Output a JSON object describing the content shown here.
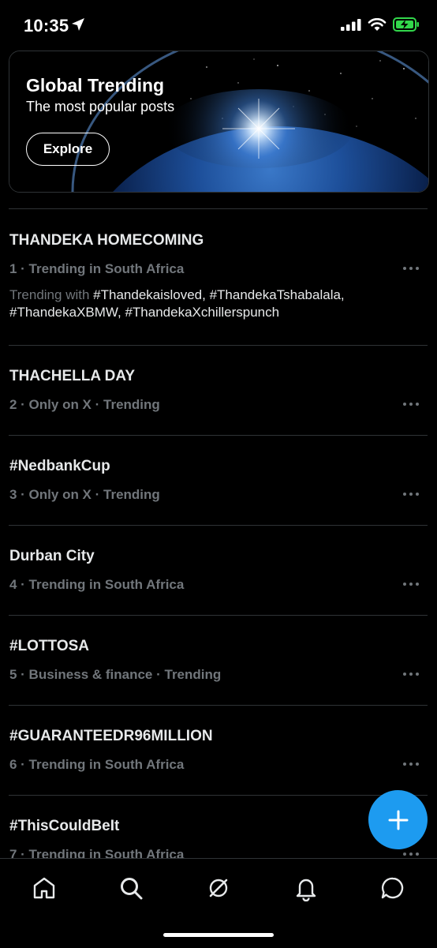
{
  "status_bar": {
    "time": "10:35"
  },
  "banner": {
    "title": "Global Trending",
    "subtitle": "The most popular posts",
    "button_label": "Explore"
  },
  "trends": [
    {
      "name": "THANDEKA HOMECOMING",
      "meta": "1 · Trending in South Africa",
      "with_lead": "Trending with ",
      "with_tags": "#Thandekaisloved, #ThandekaTshabalala, #ThandekaXBMW, #ThandekaXchillerspunch"
    },
    {
      "name": "THACHELLA DAY",
      "meta": "2 · Only on X · Trending"
    },
    {
      "name": "#NedbankCup",
      "meta": "3 · Only on X · Trending"
    },
    {
      "name": "Durban City",
      "meta": "4 · Trending in South Africa"
    },
    {
      "name": "#LOTTOSA",
      "meta": "5 · Business & finance · Trending"
    },
    {
      "name": "#GUARANTEEDR96MILLION",
      "meta": "6 · Trending in South Africa"
    },
    {
      "name": "#ThisCouldBeIt",
      "meta": "7 · Trending in South Africa"
    }
  ],
  "tab_bar": {
    "items": [
      "home-icon",
      "search-icon",
      "grok-icon",
      "notifications-icon",
      "messages-icon"
    ]
  },
  "colors": {
    "accent": "#1d9bf0",
    "muted": "#71767b",
    "text": "#e7e9ea",
    "divider": "#2f3336",
    "battery": "#32d74b"
  }
}
